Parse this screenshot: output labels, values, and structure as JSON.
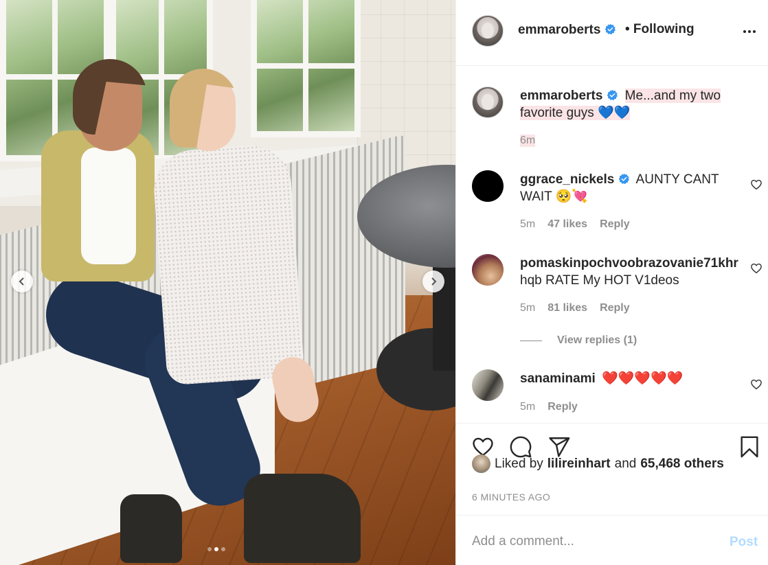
{
  "post": {
    "carousel": {
      "slide_count": 3,
      "active_slide": 2
    }
  },
  "header": {
    "username": "emmaroberts",
    "follow_status": "• Following",
    "verified_icon": "verified-badge-icon",
    "more_icon": "more-options-icon"
  },
  "caption": {
    "username": "emmaroberts",
    "text": "Me...and my two favorite guys 💙💙",
    "time": "6m"
  },
  "comments": [
    {
      "username": "ggrace_nickels",
      "verified": true,
      "text": "AUNTY CANT WAIT 🥺💘",
      "time": "5m",
      "likes": "47 likes",
      "reply": "Reply"
    },
    {
      "username": "pomaskinpochvoobrazovanie71khr",
      "verified": false,
      "text": "hqb RATE My HOT V1deos",
      "time": "5m",
      "likes": "81 likes",
      "reply": "Reply",
      "view_replies": "View replies (1)"
    },
    {
      "username": "sanaminami",
      "verified": false,
      "text": "❤️❤️❤️❤️❤️",
      "time": "5m",
      "reply": "Reply"
    }
  ],
  "actions": {
    "icons": [
      "heart-icon",
      "comment-icon",
      "share-icon",
      "bookmark-icon"
    ]
  },
  "likes": {
    "prefix": "Liked by",
    "user": "lilireinhart",
    "joiner": "and",
    "others": "65,468 others"
  },
  "timestamp": "6 MINUTES AGO",
  "add_comment": {
    "placeholder": "Add a comment...",
    "post_label": "Post"
  },
  "colors": {
    "verified": "#3897f0",
    "post_disabled": "#b3dbff",
    "muted": "#8e8e8e",
    "highlight": "#fbe4e6"
  }
}
